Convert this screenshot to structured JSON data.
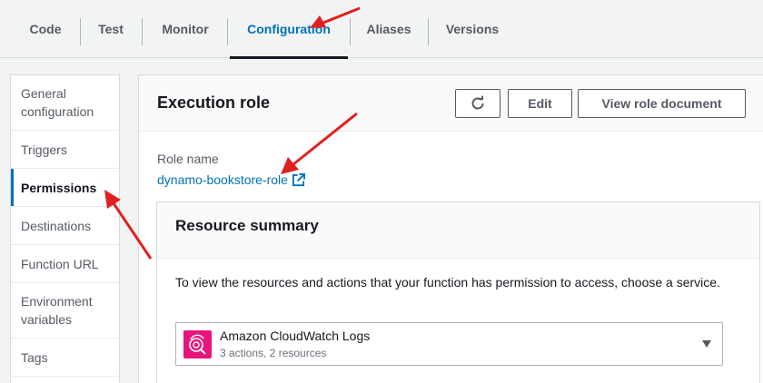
{
  "tabs": [
    {
      "label": "Code"
    },
    {
      "label": "Test"
    },
    {
      "label": "Monitor"
    },
    {
      "label": "Configuration"
    },
    {
      "label": "Aliases"
    },
    {
      "label": "Versions"
    }
  ],
  "active_tab": "Configuration",
  "sidenav": {
    "items": [
      {
        "label": "General configuration"
      },
      {
        "label": "Triggers"
      },
      {
        "label": "Permissions"
      },
      {
        "label": "Destinations"
      },
      {
        "label": "Function URL"
      },
      {
        "label": "Environment variables"
      },
      {
        "label": "Tags"
      }
    ],
    "active": "Permissions"
  },
  "execution_role": {
    "title": "Execution role",
    "edit_label": "Edit",
    "view_label": "View role document",
    "role_name_label": "Role name",
    "role_name": "dynamo-bookstore-role"
  },
  "resource_summary": {
    "title": "Resource summary",
    "description": "To view the resources and actions that your function has permission to access, choose a service.",
    "selected_service": {
      "name": "Amazon CloudWatch Logs",
      "detail": "3 actions, 2 resources",
      "icon": "cloudwatch-logs-icon"
    }
  },
  "colors": {
    "link": "#0073bb",
    "active_indicator": "#0073bb",
    "service_icon_bg": "#e7157b",
    "annotation_arrow": "#e02020"
  }
}
